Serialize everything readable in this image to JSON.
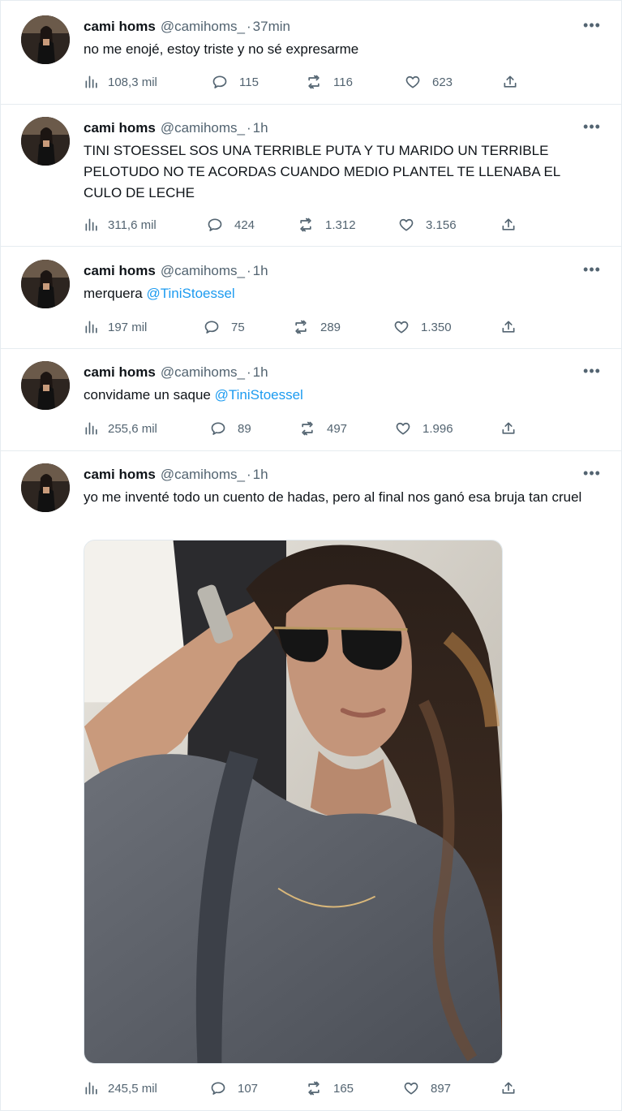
{
  "tweets": [
    {
      "name": "cami homs",
      "handle": "@camihoms_",
      "separator": "·",
      "time": "37min",
      "text_plain": "no me enojé, estoy triste y no sé expresarme",
      "text_mention": "",
      "stats": {
        "views": "108,3 mil",
        "replies": "115",
        "retweets": "116",
        "likes": "623"
      }
    },
    {
      "name": "cami homs",
      "handle": "@camihoms_",
      "separator": "·",
      "time": "1h",
      "text_plain": "TINI STOESSEL SOS UNA TERRIBLE PUTA Y TU MARIDO UN TERRIBLE PELOTUDO NO TE ACORDAS CUANDO MEDIO PLANTEL TE LLENABA EL CULO DE LECHE",
      "text_mention": "",
      "stats": {
        "views": "311,6 mil",
        "replies": "424",
        "retweets": "1.312",
        "likes": "3.156"
      }
    },
    {
      "name": "cami homs",
      "handle": "@camihoms_",
      "separator": "·",
      "time": "1h",
      "text_plain": "merquera ",
      "text_mention": "@TiniStoessel",
      "stats": {
        "views": "197 mil",
        "replies": "75",
        "retweets": "289",
        "likes": "1.350"
      }
    },
    {
      "name": "cami homs",
      "handle": "@camihoms_",
      "separator": "·",
      "time": "1h",
      "text_plain": "convidame un saque ",
      "text_mention": "@TiniStoessel",
      "stats": {
        "views": "255,6 mil",
        "replies": "89",
        "retweets": "497",
        "likes": "1.996"
      }
    },
    {
      "name": "cami homs",
      "handle": "@camihoms_",
      "separator": "·",
      "time": "1h",
      "text_plain": "yo me inventé todo un cuento de hadas, pero al final nos ganó esa bruja tan cruel",
      "text_mention": "",
      "stats": {
        "views": "245,5 mil",
        "replies": "107",
        "retweets": "165",
        "likes": "897"
      }
    }
  ],
  "icons": {
    "more": "more-icon",
    "views": "views-icon",
    "reply": "reply-icon",
    "retweet": "retweet-icon",
    "like": "like-icon",
    "share": "share-icon"
  },
  "colors": {
    "text": "#0f1419",
    "secondary": "#536471",
    "mention": "#1d9bf0",
    "divider": "#e6ecf0"
  }
}
